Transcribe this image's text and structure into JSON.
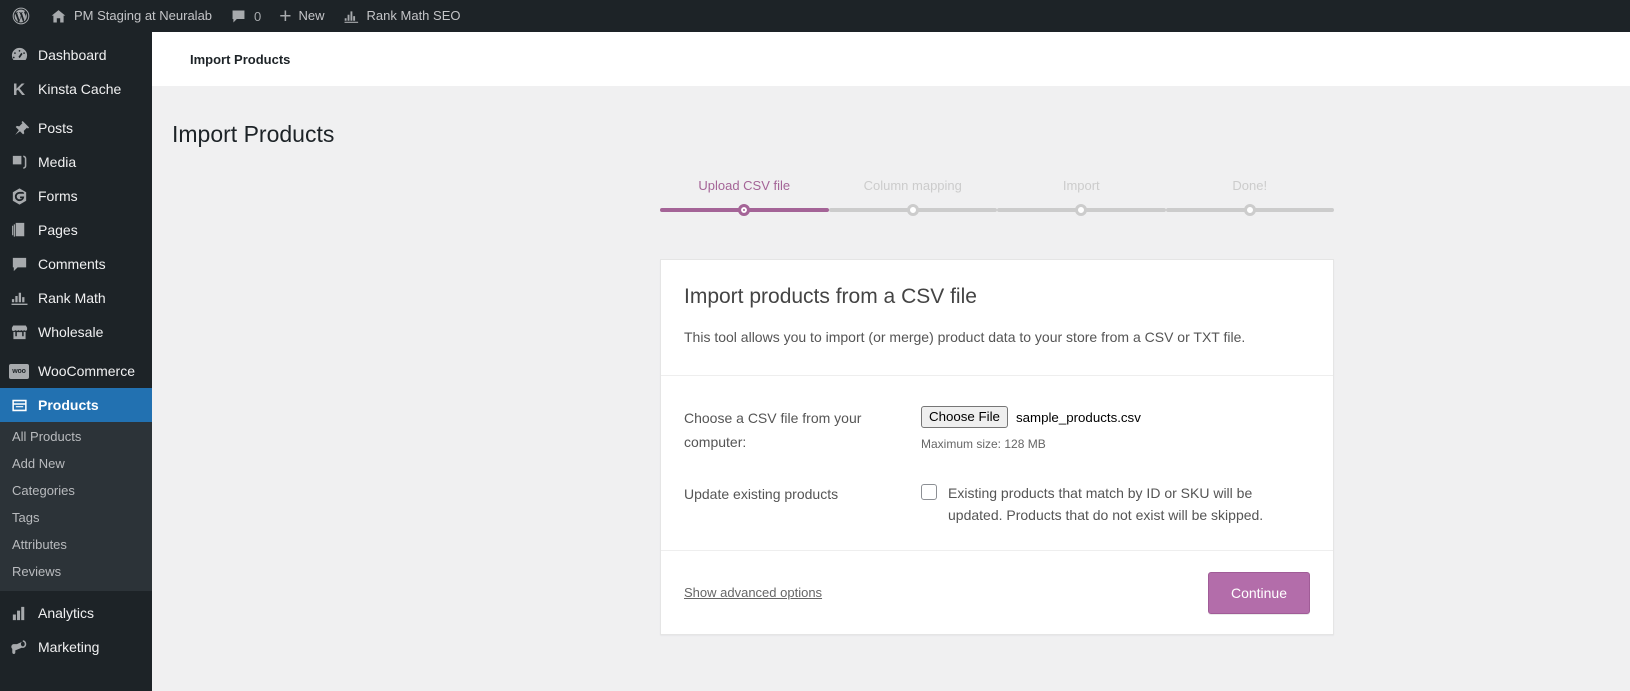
{
  "adminbar": {
    "site_name": "PM Staging at Neuralab",
    "comment_count": "0",
    "new_label": "New",
    "rank_math_label": "Rank Math SEO",
    "icons": {
      "wordpress": "wordpress-logo-icon",
      "home": "home-icon",
      "comments": "comment-bubble-icon",
      "plus": "plus-icon",
      "rank_math": "rank-math-icon"
    }
  },
  "sidebar": {
    "items": [
      {
        "label": "Dashboard",
        "icon": "dashboard-icon",
        "current": false
      },
      {
        "label": "Kinsta Cache",
        "icon": "kinsta-k-icon",
        "current": false
      },
      {
        "label": "Posts",
        "icon": "pin-icon",
        "current": false
      },
      {
        "label": "Media",
        "icon": "media-icon",
        "current": false
      },
      {
        "label": "Forms",
        "icon": "forms-icon",
        "current": false
      },
      {
        "label": "Pages",
        "icon": "pages-icon",
        "current": false
      },
      {
        "label": "Comments",
        "icon": "comment-bubble-icon",
        "current": false
      },
      {
        "label": "Rank Math",
        "icon": "rank-math-icon",
        "current": false
      },
      {
        "label": "Wholesale",
        "icon": "store-icon",
        "current": false
      },
      {
        "label": "WooCommerce",
        "icon": "woocommerce-icon",
        "current": false
      },
      {
        "label": "Products",
        "icon": "products-icon",
        "current": true
      },
      {
        "label": "Analytics",
        "icon": "bar-chart-icon",
        "current": false
      },
      {
        "label": "Marketing",
        "icon": "megaphone-icon",
        "current": false
      }
    ],
    "products_submenu": [
      "All Products",
      "Add New",
      "Categories",
      "Tags",
      "Attributes",
      "Reviews"
    ]
  },
  "breadcrumb": "Import Products",
  "page_title": "Import Products",
  "stepper": {
    "steps": [
      {
        "label": "Upload CSV file",
        "state": "done"
      },
      {
        "label": "Column mapping",
        "state": "todo"
      },
      {
        "label": "Import",
        "state": "todo"
      },
      {
        "label": "Done!",
        "state": "todo"
      }
    ]
  },
  "card": {
    "heading": "Import products from a CSV file",
    "description": "This tool allows you to import (or merge) product data to your store from a CSV or TXT file.",
    "file_row": {
      "label": "Choose a CSV file from your computer:",
      "button_label": "Choose File",
      "file_name": "sample_products.csv",
      "max_size_hint": "Maximum size: 128 MB"
    },
    "update_row": {
      "label": "Update existing products",
      "checkbox_checked": false,
      "description": "Existing products that match by ID or SKU will be updated. Products that do not exist will be skipped."
    },
    "footer": {
      "advanced_link": "Show advanced options",
      "continue_label": "Continue"
    }
  },
  "colors": {
    "accent_purple": "#a46497",
    "button_purple": "#b36daa",
    "admin_blue": "#2271b1",
    "admin_dark": "#1d2327",
    "content_bg": "#f0f0f1"
  }
}
